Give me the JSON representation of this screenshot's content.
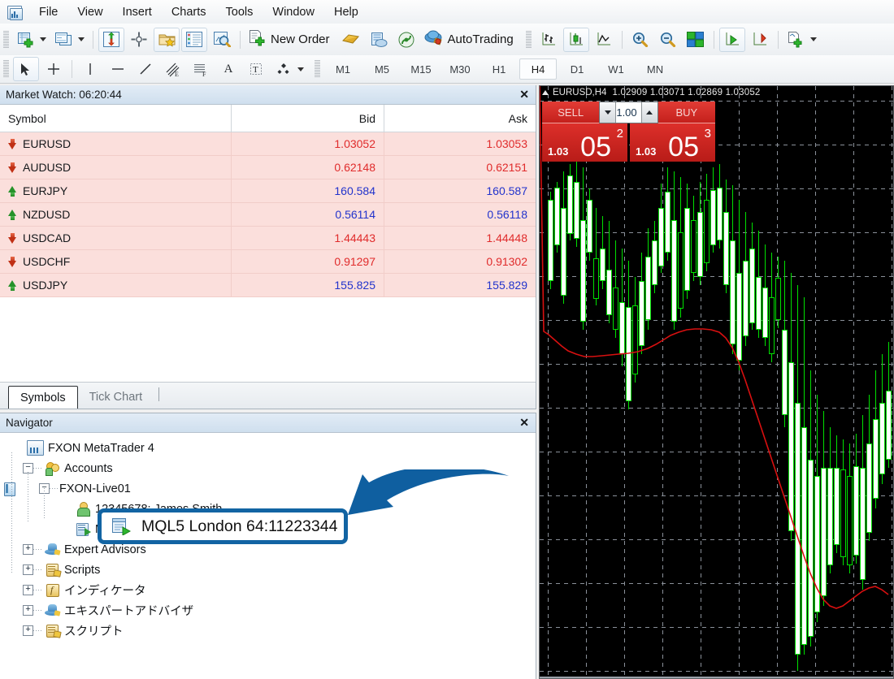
{
  "app": {
    "icon": "metatrader-logo-icon",
    "menu": [
      "File",
      "View",
      "Insert",
      "Charts",
      "Tools",
      "Window",
      "Help"
    ]
  },
  "toolbar_main": {
    "buttons": [
      {
        "name": "new-chart",
        "icon": "new-chart-icon",
        "dropdown": true
      },
      {
        "name": "profiles",
        "icon": "profiles-icon",
        "dropdown": true
      },
      {
        "name": "market-watch",
        "icon": "market-watch-icon",
        "framed": true
      },
      {
        "name": "data-window",
        "icon": "crosshair-data-window-icon",
        "framed": false
      },
      {
        "name": "navigator",
        "icon": "navigator-folder-star-icon",
        "framed": true
      },
      {
        "name": "terminal",
        "icon": "terminal-list-icon",
        "framed": true
      },
      {
        "name": "strategy-tester",
        "icon": "strategy-tester-magnifier-icon",
        "framed": false
      }
    ],
    "new_order_label": "New Order",
    "new_order_icon": "new-order-icon",
    "metaeditor_icon": "metaeditor-icon",
    "mql5_community_icon": "mql5-community-icon",
    "signals_icon": "signals-icon",
    "autotrading_label": "AutoTrading",
    "autotrading_icon": "autotrading-icon",
    "right_buttons": [
      {
        "name": "bar-chart",
        "icon": "bar-chart-icon",
        "framed": false
      },
      {
        "name": "candlestick-chart",
        "icon": "candlestick-chart-icon",
        "framed": true
      },
      {
        "name": "line-chart",
        "icon": "line-chart-icon",
        "framed": false
      },
      {
        "name": "zoom-in",
        "icon": "zoom-in-icon",
        "framed": false
      },
      {
        "name": "zoom-out",
        "icon": "zoom-out-icon",
        "framed": false
      },
      {
        "name": "tile-windows",
        "icon": "tile-windows-icon",
        "framed": false
      },
      {
        "name": "auto-scroll",
        "icon": "auto-scroll-icon",
        "framed": true
      },
      {
        "name": "chart-shift",
        "icon": "chart-shift-icon",
        "framed": false
      },
      {
        "name": "indicators",
        "icon": "indicators-icon",
        "dropdown": true
      }
    ]
  },
  "toolbar_line": {
    "tools": [
      {
        "name": "cursor",
        "icon": "cursor-arrow-icon",
        "active": true
      },
      {
        "name": "crosshair",
        "icon": "crosshair-icon",
        "active": false
      },
      {
        "name": "vertical-line",
        "icon": "vertical-line-icon",
        "active": false
      },
      {
        "name": "horizontal-line",
        "icon": "horizontal-line-icon",
        "active": false
      },
      {
        "name": "trendline",
        "icon": "trendline-icon",
        "active": false
      },
      {
        "name": "equidistant-channel",
        "icon": "equidistant-channel-icon",
        "active": false
      },
      {
        "name": "fibonacci-retracement",
        "icon": "fibonacci-retracement-icon",
        "active": false
      },
      {
        "name": "text",
        "icon": "text-a-icon",
        "active": false
      },
      {
        "name": "text-label",
        "icon": "text-label-icon",
        "active": false
      },
      {
        "name": "shapes",
        "icon": "shapes-icon",
        "active": false,
        "dropdown": true
      }
    ],
    "timeframes": [
      "M1",
      "M5",
      "M15",
      "M30",
      "H1",
      "H4",
      "D1",
      "W1",
      "MN"
    ],
    "active_timeframe": "H4"
  },
  "market_watch": {
    "title": "Market Watch: 06:20:44",
    "close_icon": "close-icon",
    "columns": [
      "Symbol",
      "Bid",
      "Ask"
    ],
    "rows": [
      {
        "symbol": "EURUSD",
        "dir": "down",
        "bid": "1.03052",
        "ask": "1.03053",
        "color": "down"
      },
      {
        "symbol": "AUDUSD",
        "dir": "down",
        "bid": "0.62148",
        "ask": "0.62151",
        "color": "down"
      },
      {
        "symbol": "EURJPY",
        "dir": "up",
        "bid": "160.584",
        "ask": "160.587",
        "color": "up"
      },
      {
        "symbol": "NZDUSD",
        "dir": "up",
        "bid": "0.56114",
        "ask": "0.56118",
        "color": "up"
      },
      {
        "symbol": "USDCAD",
        "dir": "down",
        "bid": "1.44443",
        "ask": "1.44448",
        "color": "down"
      },
      {
        "symbol": "USDCHF",
        "dir": "down",
        "bid": "0.91297",
        "ask": "0.91302",
        "color": "down"
      },
      {
        "symbol": "USDJPY",
        "dir": "up",
        "bid": "155.825",
        "ask": "155.829",
        "color": "up"
      }
    ],
    "tabs": [
      {
        "label": "Symbols",
        "active": true
      },
      {
        "label": "Tick Chart",
        "active": false
      }
    ]
  },
  "navigator": {
    "title": "Navigator",
    "close_icon": "close-icon",
    "tree": [
      {
        "label": "FXON MetaTrader 4",
        "icon": "metatrader-icon",
        "depth": 0,
        "expander": ""
      },
      {
        "label": "Accounts",
        "icon": "accounts-icon",
        "depth": 1,
        "expander": "−"
      },
      {
        "label": "FXON-Live01",
        "icon": "server-icon",
        "depth": 2,
        "expander": "−"
      },
      {
        "label": "12345678: James Smith",
        "icon": "user-account-icon",
        "depth": 3,
        "expander": ""
      },
      {
        "label": "MQL5 London 64:11223344",
        "icon": "mql5-vps-icon",
        "depth": 3,
        "expander": "",
        "highlighted": true
      },
      {
        "label": "Expert Advisors",
        "icon": "expert-advisor-hat-icon",
        "depth": 1,
        "expander": "+"
      },
      {
        "label": "Scripts",
        "icon": "script-icon",
        "depth": 1,
        "expander": "+"
      },
      {
        "label": "インディケータ",
        "icon": "indicator-icon",
        "depth": 1,
        "expander": "+"
      },
      {
        "label": "エキスパートアドバイザ",
        "icon": "expert-advisor-hat-icon",
        "depth": 1,
        "expander": "+"
      },
      {
        "label": "スクリプト",
        "icon": "script-icon",
        "depth": 1,
        "expander": "+"
      }
    ]
  },
  "chart": {
    "header": "EURUSD,H4",
    "ohlc": "1.02909 1.03071 1.02869 1.03052",
    "collapse_icon": "collapse-triangle-icon",
    "one_click": {
      "sell_label": "SELL",
      "buy_label": "BUY",
      "volume": "1.00",
      "volume_down_icon": "spinner-down-icon",
      "volume_up_icon": "spinner-up-icon",
      "sell_price_prefix": "1.03",
      "sell_price_big": "05",
      "sell_price_sup": "2",
      "buy_price_prefix": "1.03",
      "buy_price_big": "05",
      "buy_price_sup": "3"
    }
  },
  "annotation": {
    "callout_text": "MQL5 London 64:11223344",
    "callout_icon": "mql5-vps-icon",
    "arrow_icon": "curved-arrow-icon",
    "accent_color": "#1264a3"
  },
  "chart_data": {
    "type": "candlestick",
    "title": "EURUSD,H4",
    "open": 1.02909,
    "high": 1.03071,
    "low": 1.02869,
    "close": 1.03052,
    "indicator": {
      "name": "moving-average",
      "color": "#d81010"
    },
    "bull_color": "#00e000",
    "background": "#000000",
    "grid": true
  }
}
